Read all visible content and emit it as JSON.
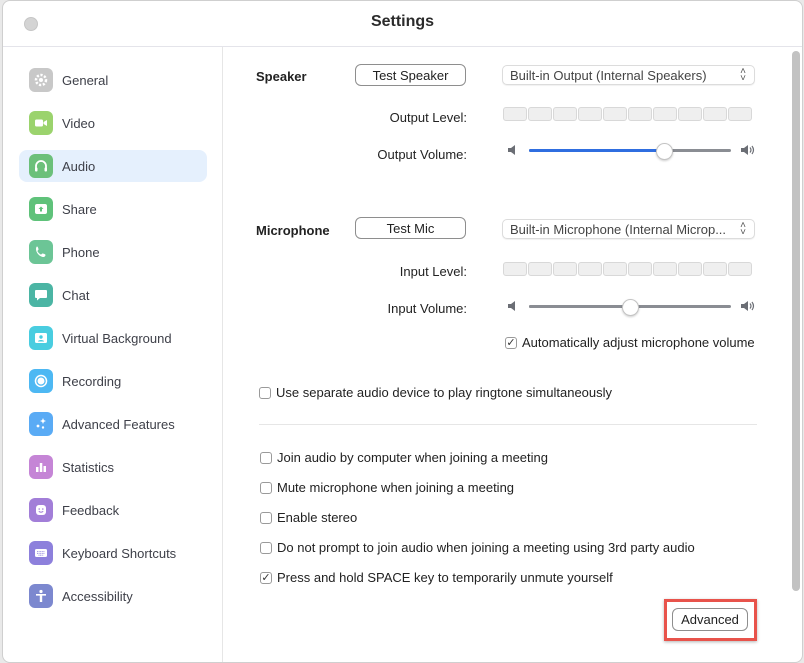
{
  "window": {
    "title": "Settings"
  },
  "sidebar": {
    "active": "Audio",
    "items": [
      {
        "label": "General",
        "icon": "gear-icon",
        "color": "#c8c8c8"
      },
      {
        "label": "Video",
        "icon": "video-camera-icon",
        "color": "#9bd36d"
      },
      {
        "label": "Audio",
        "icon": "headphones-icon",
        "color": "#6cc07a"
      },
      {
        "label": "Share",
        "icon": "share-screen-icon",
        "color": "#5fc27a"
      },
      {
        "label": "Phone",
        "icon": "phone-icon",
        "color": "#6cc596"
      },
      {
        "label": "Chat",
        "icon": "chat-bubble-icon",
        "color": "#4bb5a4"
      },
      {
        "label": "Virtual Background",
        "icon": "person-portrait-icon",
        "color": "#49cde0"
      },
      {
        "label": "Recording",
        "icon": "record-icon",
        "color": "#4db8f3"
      },
      {
        "label": "Advanced Features",
        "icon": "sparkles-icon",
        "color": "#5aabf5"
      },
      {
        "label": "Statistics",
        "icon": "bar-chart-icon",
        "color": "#c585d6"
      },
      {
        "label": "Feedback",
        "icon": "smiley-icon",
        "color": "#a27ed8"
      },
      {
        "label": "Keyboard Shortcuts",
        "icon": "keyboard-icon",
        "color": "#8d80dc"
      },
      {
        "label": "Accessibility",
        "icon": "accessibility-icon",
        "color": "#7c88cf"
      }
    ]
  },
  "speaker": {
    "section_label": "Speaker",
    "test_button": "Test Speaker",
    "device": "Built-in Output (Internal Speakers)",
    "level_label": "Output Level:",
    "volume_label": "Output Volume:",
    "volume_percent": 67,
    "level_segments": 10
  },
  "microphone": {
    "section_label": "Microphone",
    "test_button": "Test Mic",
    "device": "Built-in Microphone (Internal Microp...",
    "level_label": "Input Level:",
    "volume_label": "Input Volume:",
    "volume_percent": 50,
    "level_segments": 10,
    "auto_adjust": {
      "label": "Automatically adjust microphone volume",
      "checked": true
    }
  },
  "ringtone": {
    "label": "Use separate audio device to play ringtone simultaneously",
    "checked": false
  },
  "options": [
    {
      "label": "Join audio by computer when joining a meeting",
      "checked": false
    },
    {
      "label": "Mute microphone when joining a meeting",
      "checked": false
    },
    {
      "label": "Enable stereo",
      "checked": false
    },
    {
      "label": "Do not prompt to join audio when joining a meeting using 3rd party audio",
      "checked": false
    },
    {
      "label": "Press and hold SPACE key to temporarily unmute yourself",
      "checked": true
    }
  ],
  "advanced_button": "Advanced",
  "accent_color": "#2f6ee0",
  "highlight_color": "#e8534b"
}
